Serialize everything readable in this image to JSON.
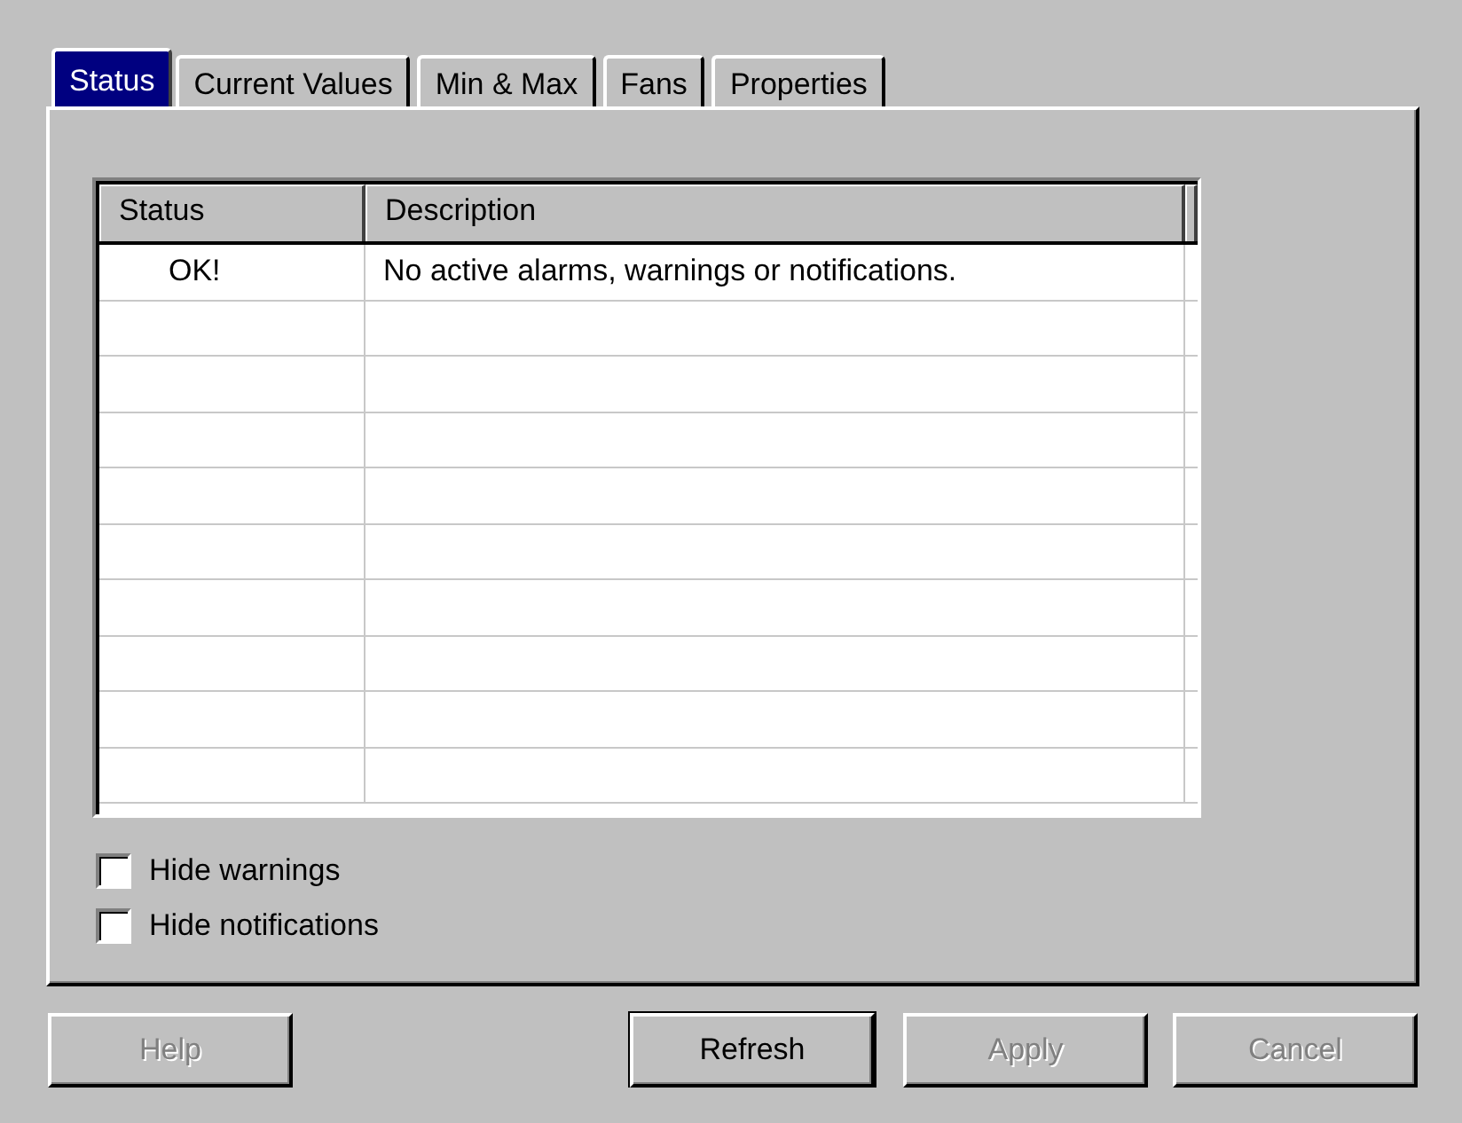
{
  "tabs": [
    {
      "label": "Status",
      "selected": true
    },
    {
      "label": "Current Values",
      "selected": false
    },
    {
      "label": "Min & Max",
      "selected": false
    },
    {
      "label": "Fans",
      "selected": false
    },
    {
      "label": "Properties",
      "selected": false
    }
  ],
  "table": {
    "columns": [
      "Status",
      "Description"
    ],
    "rows": [
      {
        "status": "OK!",
        "description": "No active alarms, warnings or notifications."
      }
    ]
  },
  "checkboxes": [
    {
      "label": "Hide warnings",
      "checked": false
    },
    {
      "label": "Hide notifications",
      "checked": false
    }
  ],
  "buttons": [
    {
      "label": "Help",
      "disabled": true,
      "default": false
    },
    {
      "label": "Refresh",
      "disabled": false,
      "default": true
    },
    {
      "label": "Apply",
      "disabled": true,
      "default": false
    },
    {
      "label": "Cancel",
      "disabled": true,
      "default": false
    }
  ]
}
